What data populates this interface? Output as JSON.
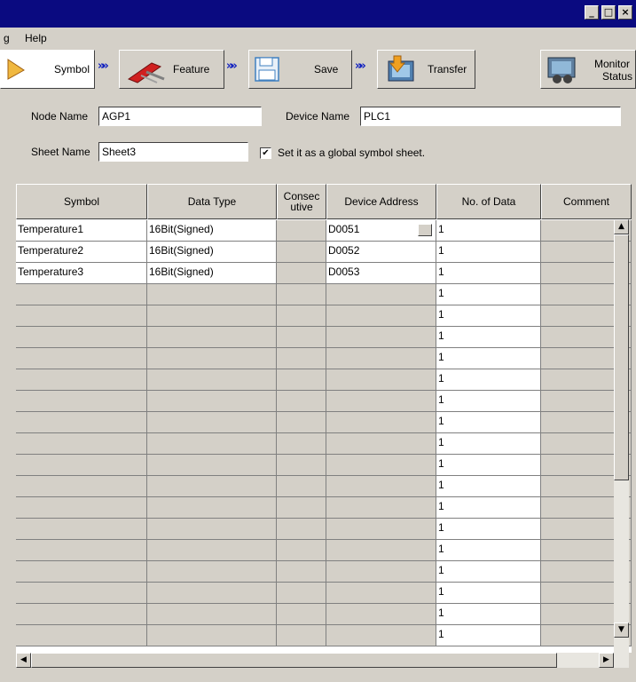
{
  "window": {
    "minimize": "_",
    "maximize": "□",
    "close": "×"
  },
  "menu": {
    "partial": "g",
    "help": "Help"
  },
  "toolbar": {
    "symbol": "Symbol",
    "feature": "Feature",
    "save": "Save",
    "transfer": "Transfer",
    "monitor_line1": "Monitor",
    "monitor_line2": "Status",
    "arrow": "»»"
  },
  "form": {
    "node_name_label": "Node Name",
    "node_name_value": "AGP1",
    "device_name_label": "Device Name",
    "device_name_value": "PLC1",
    "sheet_name_label": "Sheet Name",
    "sheet_name_value": "Sheet3",
    "global_checkbox_label": "Set it as a global symbol sheet.",
    "global_checked": "✔"
  },
  "table": {
    "headers": {
      "symbol": "Symbol",
      "data_type": "Data Type",
      "consecutive_1": "Consec",
      "consecutive_2": "utive",
      "device_address": "Device Address",
      "no_of_data": "No. of Data",
      "comment": "Comment"
    },
    "rows": [
      {
        "symbol": "Temperature1",
        "data_type": "16Bit(Signed)",
        "device_address": "D0051",
        "no_of_data": "1"
      },
      {
        "symbol": "Temperature2",
        "data_type": "16Bit(Signed)",
        "device_address": "D0052",
        "no_of_data": "1"
      },
      {
        "symbol": "Temperature3",
        "data_type": "16Bit(Signed)",
        "device_address": "D0053",
        "no_of_data": "1"
      },
      {
        "symbol": "",
        "data_type": "",
        "device_address": "",
        "no_of_data": "1"
      },
      {
        "symbol": "",
        "data_type": "",
        "device_address": "",
        "no_of_data": "1"
      },
      {
        "symbol": "",
        "data_type": "",
        "device_address": "",
        "no_of_data": "1"
      },
      {
        "symbol": "",
        "data_type": "",
        "device_address": "",
        "no_of_data": "1"
      },
      {
        "symbol": "",
        "data_type": "",
        "device_address": "",
        "no_of_data": "1"
      },
      {
        "symbol": "",
        "data_type": "",
        "device_address": "",
        "no_of_data": "1"
      },
      {
        "symbol": "",
        "data_type": "",
        "device_address": "",
        "no_of_data": "1"
      },
      {
        "symbol": "",
        "data_type": "",
        "device_address": "",
        "no_of_data": "1"
      },
      {
        "symbol": "",
        "data_type": "",
        "device_address": "",
        "no_of_data": "1"
      },
      {
        "symbol": "",
        "data_type": "",
        "device_address": "",
        "no_of_data": "1"
      },
      {
        "symbol": "",
        "data_type": "",
        "device_address": "",
        "no_of_data": "1"
      },
      {
        "symbol": "",
        "data_type": "",
        "device_address": "",
        "no_of_data": "1"
      },
      {
        "symbol": "",
        "data_type": "",
        "device_address": "",
        "no_of_data": "1"
      },
      {
        "symbol": "",
        "data_type": "",
        "device_address": "",
        "no_of_data": "1"
      },
      {
        "symbol": "",
        "data_type": "",
        "device_address": "",
        "no_of_data": "1"
      },
      {
        "symbol": "",
        "data_type": "",
        "device_address": "",
        "no_of_data": "1"
      },
      {
        "symbol": "",
        "data_type": "",
        "device_address": "",
        "no_of_data": "1"
      }
    ]
  },
  "scroll": {
    "up": "▲",
    "down": "▼",
    "left": "◀",
    "right": "▶"
  },
  "colors": {
    "titlebar": "#0a0a80",
    "face": "#d4d0c8",
    "arrow": "#1020c0"
  }
}
